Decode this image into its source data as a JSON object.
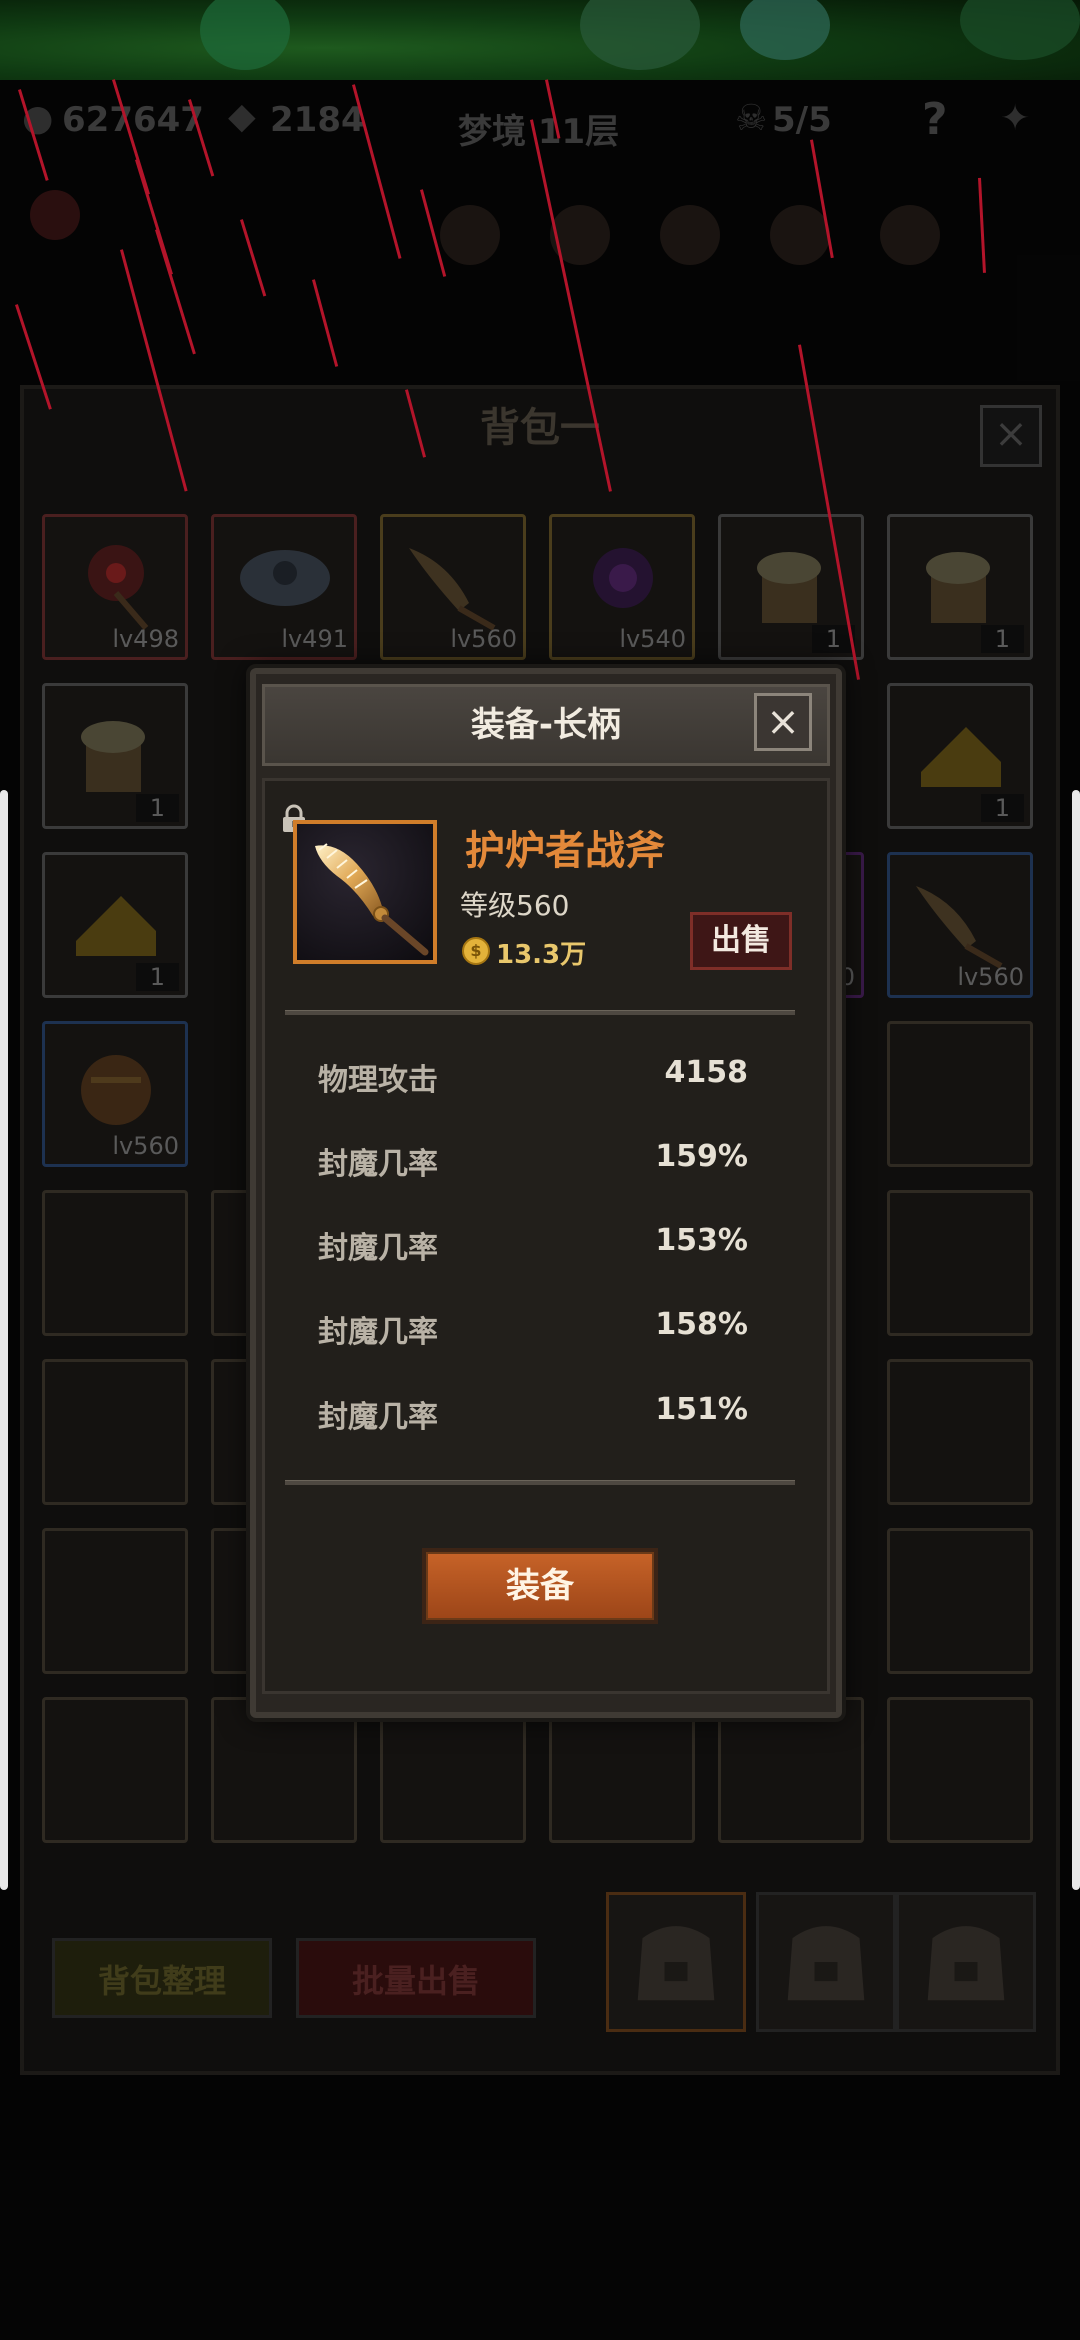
{
  "hud": {
    "gold": "627647",
    "gems": "2184",
    "dungeon": "梦境 11层",
    "skulls": "5/5",
    "help": "?"
  },
  "bag": {
    "title": "背包一",
    "close": "×",
    "sort_label": "背包整理",
    "bulk_sell_label": "批量出售",
    "slots": [
      {
        "label": "lv498"
      },
      {
        "label": "lv491"
      },
      {
        "label": "lv560"
      },
      {
        "label": "lv540"
      },
      {
        "label": "1"
      },
      {
        "label": "1"
      },
      {
        "label": "1"
      },
      {
        "label": "1"
      },
      {
        "label": "1"
      },
      {
        "label": "0"
      },
      {
        "label": "lv560"
      },
      {
        "label": "lv560"
      }
    ]
  },
  "dialog": {
    "title": "装备-长柄",
    "close": "×",
    "item_name": "护炉者战斧",
    "item_level": "等级560",
    "price": "13.3万",
    "coin_symbol": "$",
    "sell_label": "出售",
    "stats": [
      {
        "name": "物理攻击",
        "value": "4158"
      },
      {
        "name": "封魔几率",
        "value": "159%"
      },
      {
        "name": "封魔几率",
        "value": "153%"
      },
      {
        "name": "封魔几率",
        "value": "158%"
      },
      {
        "name": "封魔几率",
        "value": "151%"
      }
    ],
    "equip_label": "装备"
  },
  "colors": {
    "item_name": "#e3893a",
    "accent_orange": "#c76328",
    "sell_red": "#3e1616",
    "rain": "#b3142a"
  }
}
